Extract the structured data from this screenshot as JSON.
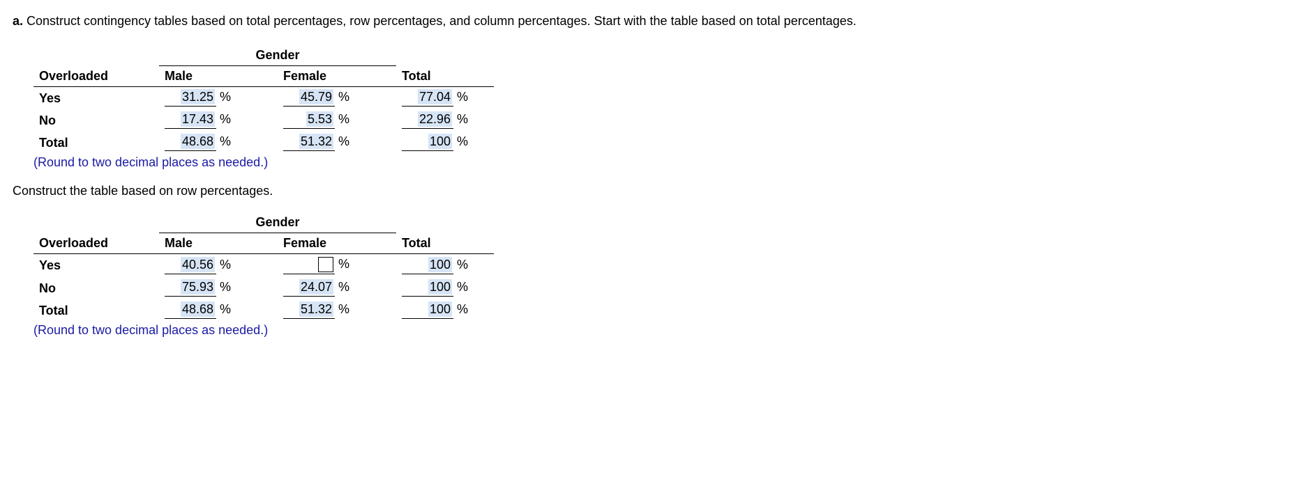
{
  "question": {
    "part_label": "a.",
    "text": " Construct contingency tables based on total percentages, row percentages, and column percentages. Start with the table based on total percentages."
  },
  "hint_text": "(Round to two decimal places as needed.)",
  "row_prompt": "Construct the table based on row percentages.",
  "headers": {
    "gender": "Gender",
    "overloaded": "Overloaded",
    "male": "Male",
    "female": "Female",
    "total": "Total",
    "yes": "Yes",
    "no": "No"
  },
  "table1": {
    "yes": {
      "male": "31.25",
      "female": "45.79",
      "total": "77.04"
    },
    "no": {
      "male": "17.43",
      "female": "5.53",
      "total": "22.96"
    },
    "total": {
      "male": "48.68",
      "female": "51.32",
      "total": "100"
    }
  },
  "table2": {
    "yes": {
      "male": "40.56",
      "female": "",
      "total": "100"
    },
    "no": {
      "male": "75.93",
      "female": "24.07",
      "total": "100"
    },
    "total": {
      "male": "48.68",
      "female": "51.32",
      "total": "100"
    }
  },
  "pct": "%"
}
